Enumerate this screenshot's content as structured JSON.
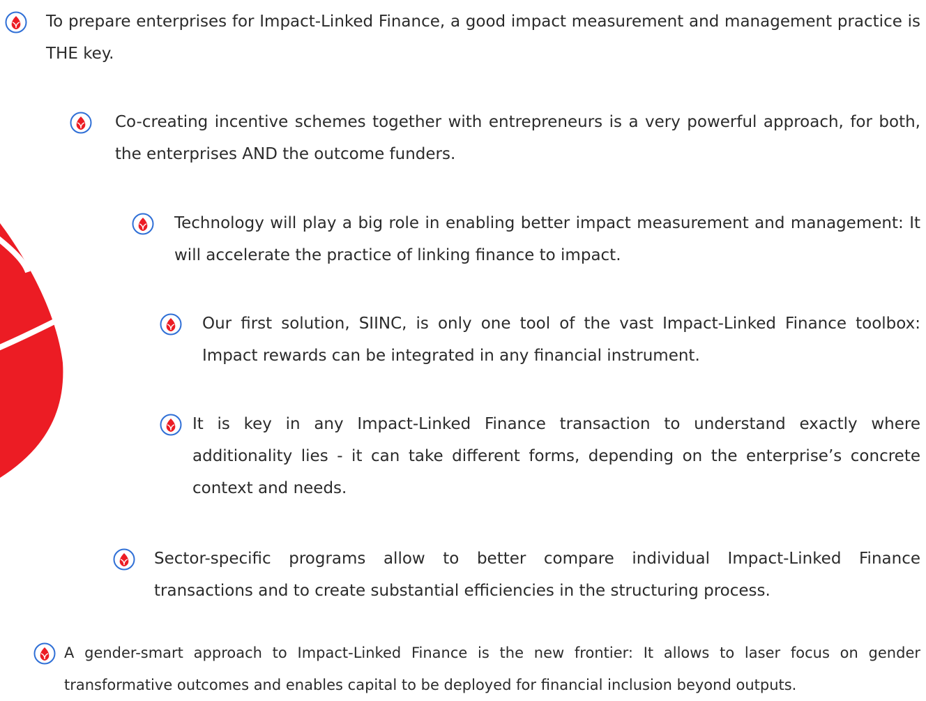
{
  "accent_color": "#ec1c24",
  "bullet_icon": "red-leaf-bullet-icon",
  "decor_icon": "red-leaf-shape-icon",
  "bullets": [
    "To prepare enterprises for Impact-Linked Finance, a good impact measurement and management practice is THE key.",
    "Co-creating incentive schemes together with entrepreneurs is a very powerful approach, for both, the enterprises AND the outcome funders.",
    "Technology will play a big role in enabling better impact measurement and management: It will accelerate the practice of linking finance to impact.",
    "Our first solution, SIINC, is only one tool of the vast Impact-Linked Finance toolbox: Impact rewards can be integrated in any financial instrument.",
    "It is key in any Impact-Linked Finance transaction to understand exactly where additionality lies - it can take different forms, depending on the enterprise’s concrete context and needs.",
    "Sector-specific programs allow to better compare individual Impact-Linked Finance transactions and to create substantial efficiencies in the structuring process.",
    "A gender-smart approach to Impact-Linked Finance is the new frontier: It allows to laser focus on gender transformative outcomes and enables capital to be deployed for financial inclusion beyond outputs."
  ]
}
